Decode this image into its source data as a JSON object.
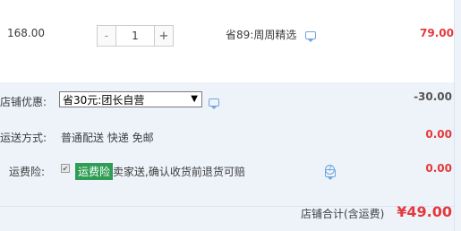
{
  "item": {
    "price": "168.00",
    "qty_minus": "-",
    "qty_value": "1",
    "qty_plus": "+",
    "promo_text": "省89:周周精选",
    "subtotal": "79.00"
  },
  "shop": {
    "discount_label": "店铺优惠:",
    "discount_option": "省30元:团长自营",
    "discount_amount": "-30.00",
    "shipping_label": "运送方式:",
    "shipping_value": "普通配送 快递 免邮",
    "shipping_amount": "0.00",
    "insurance_label": "运费险:",
    "insurance_badge": "运费险",
    "insurance_desc": "卖家送,确认收货前退货可赔",
    "insurance_amount": "0.00",
    "total_label": "店铺合计(含运费)",
    "total_amount": "¥49.00",
    "help_symbol": "?",
    "check_symbol": "✔",
    "arrow_symbol": "▼"
  },
  "colors": {
    "accent_red": "#e4393c",
    "panel_bg": "#eef3fa",
    "badge_green": "#2f9d54",
    "icon_blue": "#6fa6e0"
  }
}
